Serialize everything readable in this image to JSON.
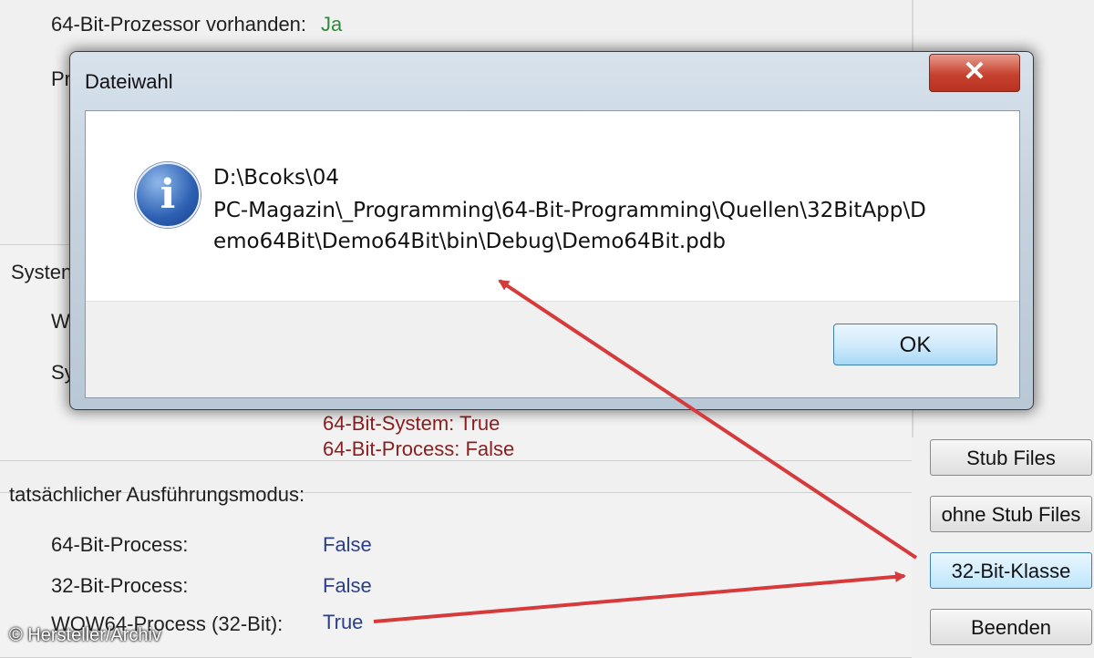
{
  "background": {
    "processor_label": "64-Bit-Prozessor vorhanden:",
    "processor_value": "Ja",
    "system_lines": [
      "64-Bit-System: True",
      "64-Bit-Process: False"
    ],
    "mode_heading": "tatsächlicher Ausführungsmodus:",
    "mode_rows": [
      {
        "label": "64-Bit-Process:",
        "value": "False"
      },
      {
        "label": "32-Bit-Process:",
        "value": "False"
      },
      {
        "label": "WOW64-Process (32-Bit):",
        "value": "True"
      }
    ],
    "buttons": [
      "Stub Files",
      "ohne Stub Files",
      "32-Bit-Klasse",
      "Beenden"
    ]
  },
  "dialog": {
    "title": "Dateiwahl",
    "message_lines": [
      "D:\\Bcoks\\04",
      "PC-Magazin\\_Programming\\64-Bit-Programming\\Quellen\\32BitApp\\D",
      "emo64Bit\\Demo64Bit\\bin\\Debug\\Demo64Bit.pdb"
    ],
    "ok_label": "OK",
    "close_glyph": "✕",
    "icon": "info-icon"
  },
  "credit": "© Hersteller/Archiv",
  "colors": {
    "arrow": "#d63a3a",
    "green": "#2f8a3a",
    "blue": "#2a3f87",
    "red": "#8b1e1e"
  }
}
